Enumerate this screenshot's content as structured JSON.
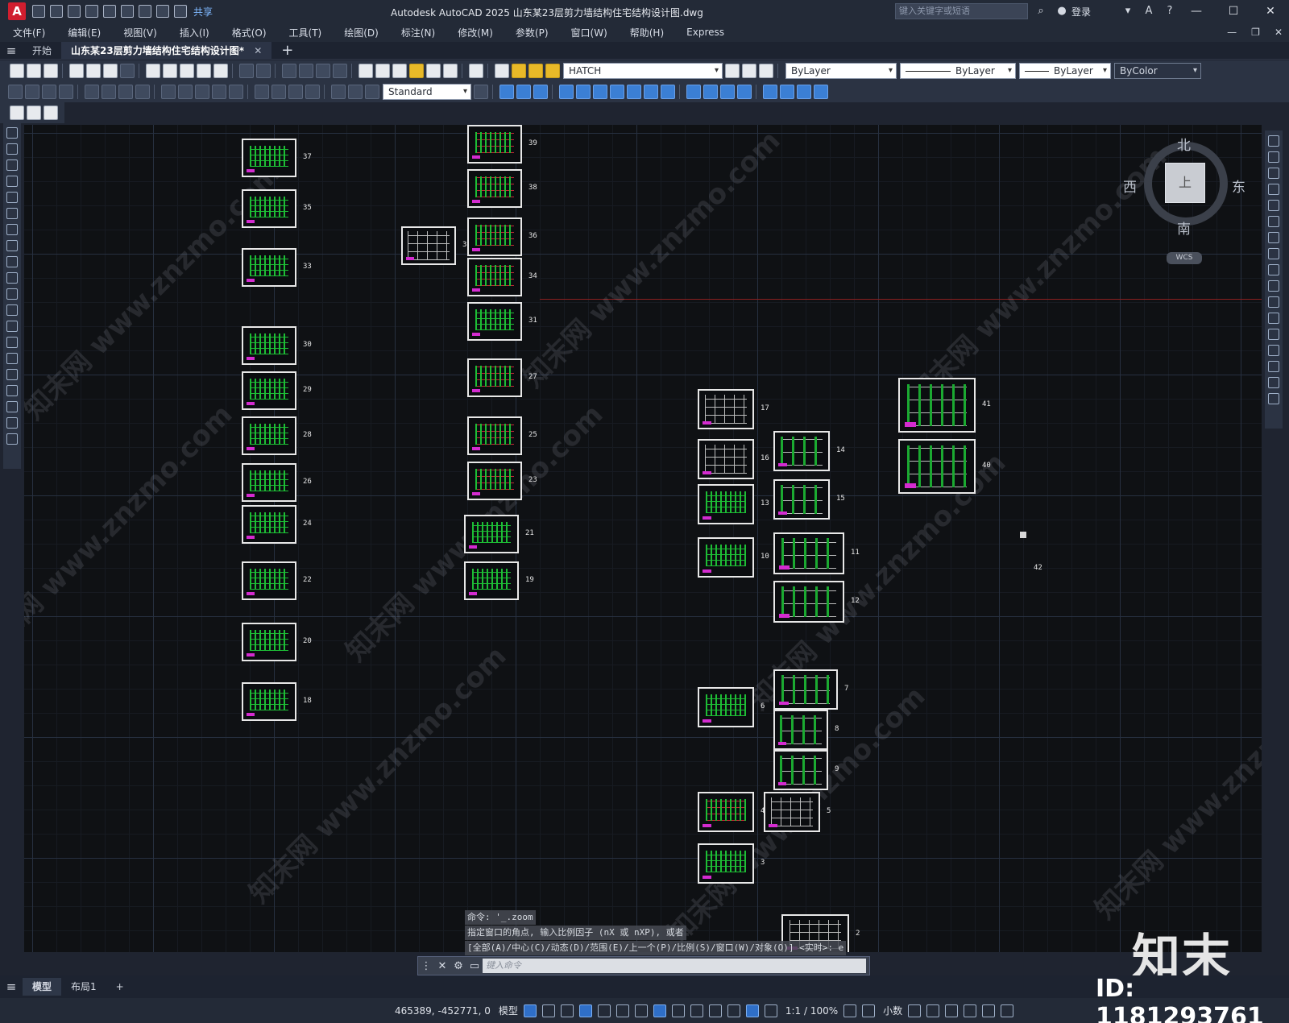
{
  "titlebar": {
    "app_icon": "A",
    "share_label": "共享",
    "title": "Autodesk AutoCAD 2025    山东某23层剪力墙结构住宅结构设计图.dwg",
    "search_placeholder": "键入关键字或短语",
    "login_label": "登录",
    "min_glyph": "—",
    "max_glyph": "☐",
    "close_glyph": "✕"
  },
  "menubar": {
    "items": [
      "文件(F)",
      "编辑(E)",
      "视图(V)",
      "插入(I)",
      "格式(O)",
      "工具(T)",
      "绘图(D)",
      "标注(N)",
      "修改(M)",
      "参数(P)",
      "窗口(W)",
      "帮助(H)",
      "Express"
    ]
  },
  "tabs": {
    "start_label": "开始",
    "doc_label": "山东某23层剪力墙结构住宅结构设计图*",
    "close_glyph": "✕",
    "add_glyph": "+"
  },
  "toolbar": {
    "layer_combo": "HATCH",
    "color_combo": "ByLayer",
    "linetype_combo": "ByLayer",
    "lineweight_combo": "ByLayer",
    "plotstyle_combo": "ByColor",
    "dimstyle_combo": "Standard"
  },
  "viewcube": {
    "north": "北",
    "south": "南",
    "east": "东",
    "west": "西",
    "face": "上",
    "wcs": "WCS"
  },
  "sheets": [
    {
      "label": "37",
      "kind": "plan"
    },
    {
      "label": "35",
      "kind": "plan"
    },
    {
      "label": "33",
      "kind": "plan"
    },
    {
      "label": "30",
      "kind": "plan"
    },
    {
      "label": "29",
      "kind": "plan"
    },
    {
      "label": "28",
      "kind": "plan"
    },
    {
      "label": "26",
      "kind": "plan"
    },
    {
      "label": "24",
      "kind": "plan"
    },
    {
      "label": "22",
      "kind": "plan"
    },
    {
      "label": "20",
      "kind": "plan"
    },
    {
      "label": "18",
      "kind": "plan"
    },
    {
      "label": "32",
      "kind": "detail"
    },
    {
      "label": "39",
      "kind": "mix"
    },
    {
      "label": "38",
      "kind": "mix"
    },
    {
      "label": "36",
      "kind": "mix"
    },
    {
      "label": "34",
      "kind": "mix"
    },
    {
      "label": "31",
      "kind": "plan"
    },
    {
      "label": "27",
      "kind": "mix"
    },
    {
      "label": "25",
      "kind": "mix"
    },
    {
      "label": "23",
      "kind": "mix"
    },
    {
      "label": "21",
      "kind": "plan"
    },
    {
      "label": "19",
      "kind": "plan"
    },
    {
      "label": "17",
      "kind": "detail"
    },
    {
      "label": "16",
      "kind": "detail"
    },
    {
      "label": "13",
      "kind": "plan"
    },
    {
      "label": "10",
      "kind": "plan"
    },
    {
      "label": "6",
      "kind": "plan"
    },
    {
      "label": "4",
      "kind": "mix"
    },
    {
      "label": "3",
      "kind": "plan"
    },
    {
      "label": "14",
      "kind": "col"
    },
    {
      "label": "15",
      "kind": "col"
    },
    {
      "label": "11",
      "kind": "col"
    },
    {
      "label": "12",
      "kind": "col"
    },
    {
      "label": "7",
      "kind": "col"
    },
    {
      "label": "8",
      "kind": "col"
    },
    {
      "label": "9",
      "kind": "col"
    },
    {
      "label": "5",
      "kind": "detail"
    },
    {
      "label": "41",
      "kind": "col"
    },
    {
      "label": "40",
      "kind": "col"
    },
    {
      "label": "2",
      "kind": "detail"
    }
  ],
  "stray_label": "42",
  "watermark_text": "知末网 www.znzmo.com",
  "command": {
    "history": [
      "命令: '_.zoom",
      "指定窗口的角点, 输入比例因子 (nX 或 nXP), 或者",
      "[全部(A)/中心(C)/动态(D)/范围(E)/上一个(P)/比例(S)/窗口(W)/对象(O)] <实时>: e"
    ],
    "placeholder": "键入命令"
  },
  "layout_tabs": {
    "model": "模型",
    "layout1": "布局1",
    "add": "+"
  },
  "statusbar": {
    "coords": "465389, -452771, 0",
    "model": "模型",
    "scale": "1:1 / 100%",
    "units": "小数"
  },
  "brand": {
    "logo_text": "知末",
    "id_text": "ID: 1181293761"
  }
}
